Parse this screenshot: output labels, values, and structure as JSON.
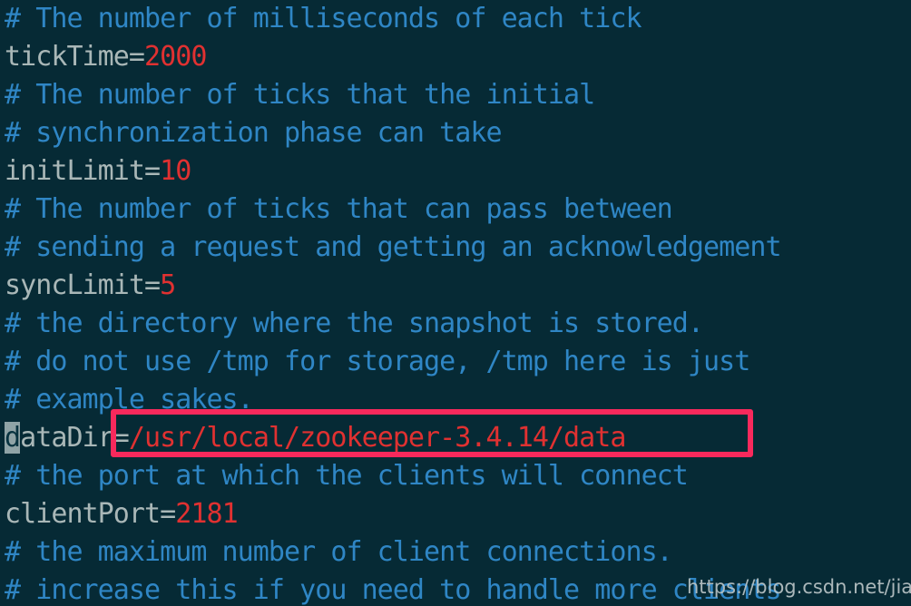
{
  "editor": {
    "background_color": "#062a35",
    "comment_color": "#2f86c5",
    "key_color": "#a9b7b7",
    "value_color": "#e03131",
    "cursor_color": "#8fa3a6",
    "highlight_color": "#f8295c",
    "lines": [
      {
        "type": "comment",
        "text": "# The number of milliseconds of each tick"
      },
      {
        "type": "setting",
        "key": "tickTime",
        "eq": "=",
        "value": "2000"
      },
      {
        "type": "comment",
        "text": "# The number of ticks that the initial"
      },
      {
        "type": "comment",
        "text": "# synchronization phase can take"
      },
      {
        "type": "setting",
        "key": "initLimit",
        "eq": "=",
        "value": "10"
      },
      {
        "type": "comment",
        "text": "# The number of ticks that can pass between"
      },
      {
        "type": "comment",
        "text": "# sending a request and getting an acknowledgement"
      },
      {
        "type": "setting",
        "key": "syncLimit",
        "eq": "=",
        "value": "5"
      },
      {
        "type": "comment",
        "text": "# the directory where the snapshot is stored."
      },
      {
        "type": "comment",
        "text": "# do not use /tmp for storage, /tmp here is just"
      },
      {
        "type": "comment",
        "text": "# example sakes."
      },
      {
        "type": "setting",
        "key": "dataDir",
        "key_cursor_char": "d",
        "key_rest": "ataDir",
        "eq": "=",
        "value": "/usr/local/zookeeper-3.4.14/data",
        "highlighted": true
      },
      {
        "type": "comment",
        "text": "# the port at which the clients will connect"
      },
      {
        "type": "setting",
        "key": "clientPort",
        "eq": "=",
        "value": "2181"
      },
      {
        "type": "comment",
        "text": "# the maximum number of client connections."
      },
      {
        "type": "comment",
        "text": "# increase this if you need to handle more clients"
      }
    ]
  },
  "watermark": {
    "text": "https://blog.csdn.net/jiaobuchong"
  }
}
